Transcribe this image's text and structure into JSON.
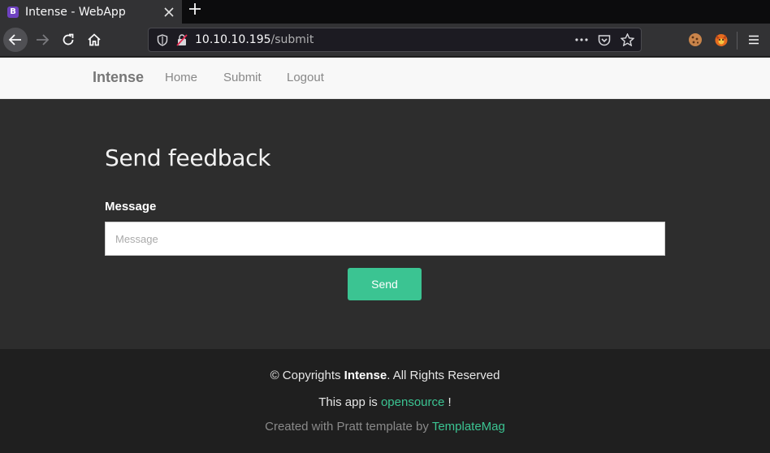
{
  "browser": {
    "tab_title": "Intense - WebApp",
    "tab_favicon_letter": "B",
    "url_host": "10.10.10.195",
    "url_path": "/submit",
    "icons": {
      "back": "arrow-left-icon",
      "forward": "arrow-right-icon",
      "reload": "reload-icon",
      "home": "home-icon",
      "tracking": "shield-icon",
      "insecure": "insecure-lock-icon",
      "page_actions": "more-icon",
      "pocket": "pocket-icon",
      "bookmark": "star-icon",
      "ext1": "cookie-icon",
      "ext2": "fox-extension-icon",
      "menu": "hamburger-icon"
    }
  },
  "site_nav": {
    "brand": "Intense",
    "links": [
      "Home",
      "Submit",
      "Logout"
    ]
  },
  "main": {
    "heading": "Send feedback",
    "message_label": "Message",
    "message_placeholder": "Message",
    "send_label": "Send"
  },
  "footer": {
    "line1_prefix": "© Copyrights ",
    "line1_brand": "Intense",
    "line1_suffix": ". All Rights Reserved",
    "line2_prefix": "This app is ",
    "line2_link": "opensource",
    "line2_suffix": " !",
    "line3_prefix": "Created with Pratt template by ",
    "line3_link": "TemplateMag"
  },
  "colors": {
    "accent": "#3bc492",
    "page_bg": "#2d2d2d",
    "footer_bg": "#1f1f1f",
    "nav_bg": "#f8f8f8"
  }
}
